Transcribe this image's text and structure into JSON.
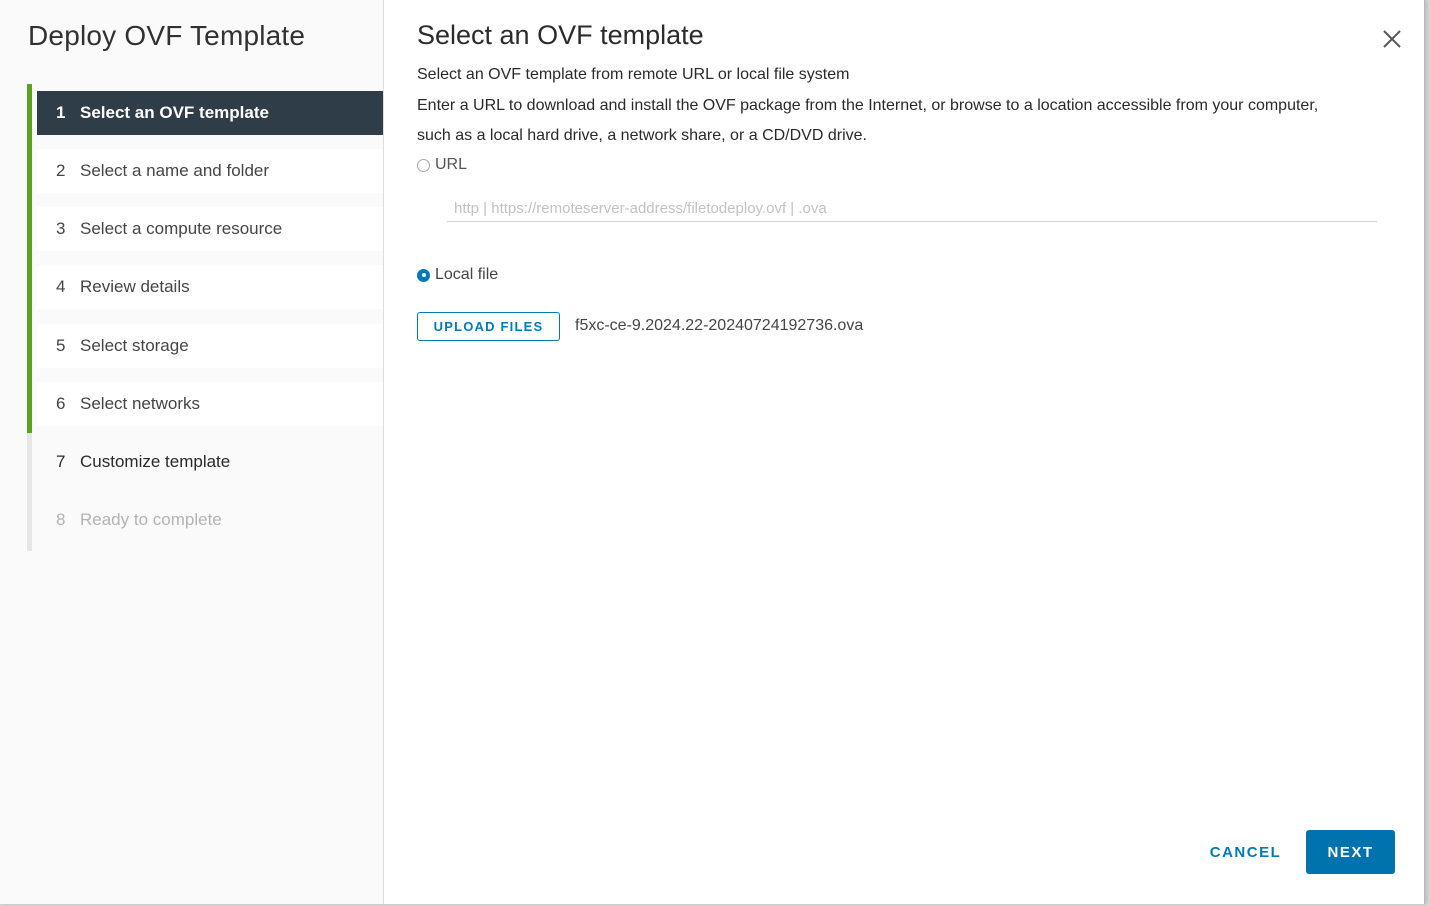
{
  "dialog": {
    "title": "Deploy OVF Template"
  },
  "steps": [
    {
      "num": "1",
      "label": "Select an OVF template",
      "state": "active"
    },
    {
      "num": "2",
      "label": "Select a name and folder",
      "state": "completed"
    },
    {
      "num": "3",
      "label": "Select a compute resource",
      "state": "completed"
    },
    {
      "num": "4",
      "label": "Review details",
      "state": "completed"
    },
    {
      "num": "5",
      "label": "Select storage",
      "state": "completed"
    },
    {
      "num": "6",
      "label": "Select networks",
      "state": "completed"
    },
    {
      "num": "7",
      "label": "Customize template",
      "state": "enabled"
    },
    {
      "num": "8",
      "label": "Ready to complete",
      "state": "disabled"
    }
  ],
  "main": {
    "title": "Select an OVF template",
    "subtitle": "Select an OVF template from remote URL or local file system",
    "description": "Enter a URL to download and install the OVF package from the Internet, or browse to a location accessible from your computer, such as a local hard drive, a network share, or a CD/DVD drive.",
    "url_option": {
      "label": "URL",
      "checked": false
    },
    "url_input": {
      "value": "",
      "placeholder": "http | https://remoteserver-address/filetodeploy.ovf | .ova"
    },
    "local_option": {
      "label": "Local file",
      "checked": true
    },
    "upload_button": "UPLOAD FILES",
    "selected_file": "f5xc-ce-9.2024.22-20240724192736.ova"
  },
  "footer": {
    "cancel_label": "CANCEL",
    "next_label": "NEXT"
  },
  "icons": {
    "close": "close-icon"
  },
  "colors": {
    "accent": "#0079b8",
    "active_step_bg": "#2e3d48",
    "progress_green": "#5aa220"
  }
}
